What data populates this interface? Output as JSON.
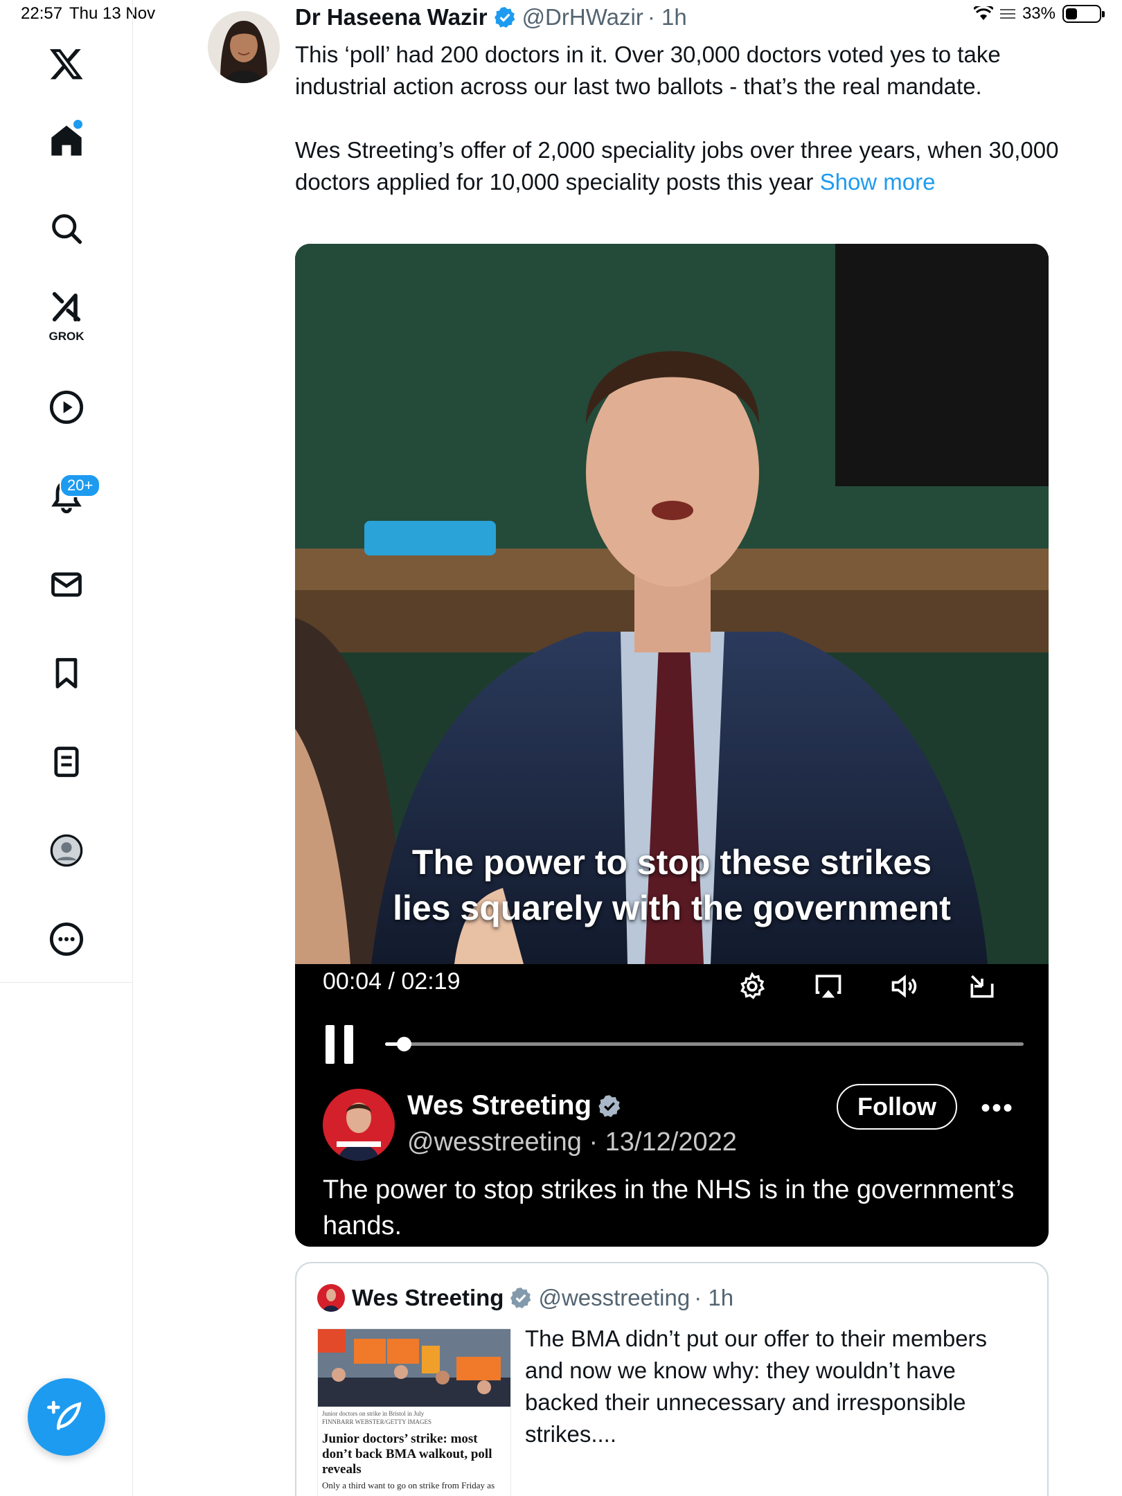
{
  "status_bar": {
    "time": "22:57",
    "date": "Thu 13 Nov",
    "battery": "33%",
    "battery_level": 0.33
  },
  "sidebar": {
    "items": [
      {
        "name": "x-logo-icon"
      },
      {
        "name": "home-icon"
      },
      {
        "name": "search-icon"
      },
      {
        "name": "grok-icon",
        "label": "GROK"
      },
      {
        "name": "video-icon"
      },
      {
        "name": "notifications-icon",
        "badge": "20+"
      },
      {
        "name": "messages-icon"
      },
      {
        "name": "bookmarks-icon"
      },
      {
        "name": "lists-icon"
      },
      {
        "name": "profile-icon"
      },
      {
        "name": "more-icon"
      }
    ],
    "compose": "compose-icon"
  },
  "post": {
    "author_name": "Dr Haseena Wazir",
    "handle": "@DrHWazir",
    "time": "· 1h",
    "paragraph1": "This ‘poll’ had 200 doctors in it. Over 30,000 doctors voted yes to take industrial action across our last two ballots - that’s the real mandate.",
    "paragraph2": "Wes Streeting’s offer of 2,000 speciality jobs over three years, when 30,000 doctors applied for 10,000 speciality posts this year",
    "show_more": "Show more"
  },
  "video": {
    "caption_line1": "The power to stop these strikes",
    "caption_line2": "lies squarely with the government",
    "time_readout": "00:04 / 02:19",
    "progress": 0.029,
    "embedded": {
      "name": "Wes Streeting",
      "handle": "@wesstreeting · 13/12/2022",
      "follow": "Follow",
      "text": "The power to stop strikes in the NHS is in the government’s hands."
    }
  },
  "quote": {
    "author_name": "Wes Streeting",
    "handle": "@wesstreeting",
    "time": "· 1h",
    "text": "The BMA didn’t put our offer to their members and now we know why: they wouldn’t have backed their unnecessary and irresponsible strikes....",
    "thumb_credit1": "Junior doctors on strike in Bristol in July",
    "thumb_credit2": "FINNBARR WEBSTER/GETTY IMAGES",
    "thumb_headline": "Junior doctors’ strike: most don’t back BMA walkout, poll reveals",
    "thumb_sub": "Only a third want to go on strike from Friday as"
  },
  "colors": {
    "accent": "#1d9bf0",
    "text": "#0f1419",
    "muted": "#536471"
  }
}
